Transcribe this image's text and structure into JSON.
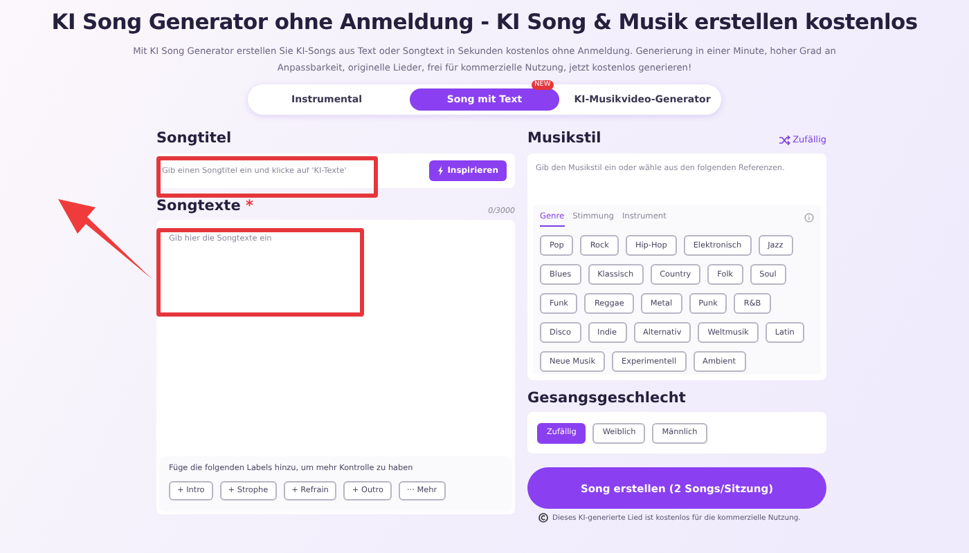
{
  "header": {
    "title": "KI Song Generator ohne Anmeldung - KI Song & Musik erstellen kostenlos",
    "subtitle": "Mit KI Song Generator erstellen Sie KI-Songs aus Text oder Songtext in Sekunden kostenlos ohne Anmeldung. Generierung in einer Minute, hoher Grad an Anpassbarkeit, originelle Lieder, frei für kommerzielle Nutzung, jetzt kostenlos generieren!"
  },
  "mode_tabs": [
    {
      "label": "Instrumental",
      "selected": false
    },
    {
      "label": "Song mit Text",
      "selected": true,
      "badge": "NEW"
    },
    {
      "label": "KI-Musikvideo-Generator",
      "selected": false
    }
  ],
  "song_title": {
    "label": "Songtitel",
    "placeholder": "Gib einen Songtitel ein und klicke auf 'KI-Texte'",
    "button": "Inspirieren"
  },
  "lyrics": {
    "label": "Songtexte",
    "required_mark": "*",
    "counter": "0/3000",
    "placeholder": "Gib hier die Songtexte ein",
    "hint": "Füge die folgenden Labels hinzu, um mehr Kontrolle zu haben",
    "tags": [
      "+ Intro",
      "+ Strophe",
      "+ Refrain",
      "+ Outro",
      "··· Mehr"
    ]
  },
  "music_style": {
    "label": "Musikstil",
    "random_link": "Zufällig",
    "placeholder": "Gib den Musikstil ein oder wähle aus den folgenden Referenzen.",
    "tabs": [
      {
        "label": "Genre",
        "selected": true
      },
      {
        "label": "Stimmung",
        "selected": false
      },
      {
        "label": "Instrument",
        "selected": false
      }
    ],
    "chips": [
      "Pop",
      "Rock",
      "Hip-Hop",
      "Elektronisch",
      "Jazz",
      "Blues",
      "Klassisch",
      "Country",
      "Folk",
      "Soul",
      "Funk",
      "Reggae",
      "Metal",
      "Punk",
      "R&B",
      "Disco",
      "Indie",
      "Alternativ",
      "Weltmusik",
      "Latin",
      "Neue Musik",
      "Experimentell",
      "Ambient"
    ]
  },
  "vocal_gender": {
    "label": "Gesangsgeschlecht",
    "options": [
      {
        "label": "Zufällig",
        "selected": true
      },
      {
        "label": "Weiblich",
        "selected": false
      },
      {
        "label": "Männlich",
        "selected": false
      }
    ]
  },
  "create_button": "Song erstellen (2 Songs/Sitzung)",
  "footer_note": "Dieses KI-generierte Lied ist kostenlos für die kommerzielle Nutzung."
}
